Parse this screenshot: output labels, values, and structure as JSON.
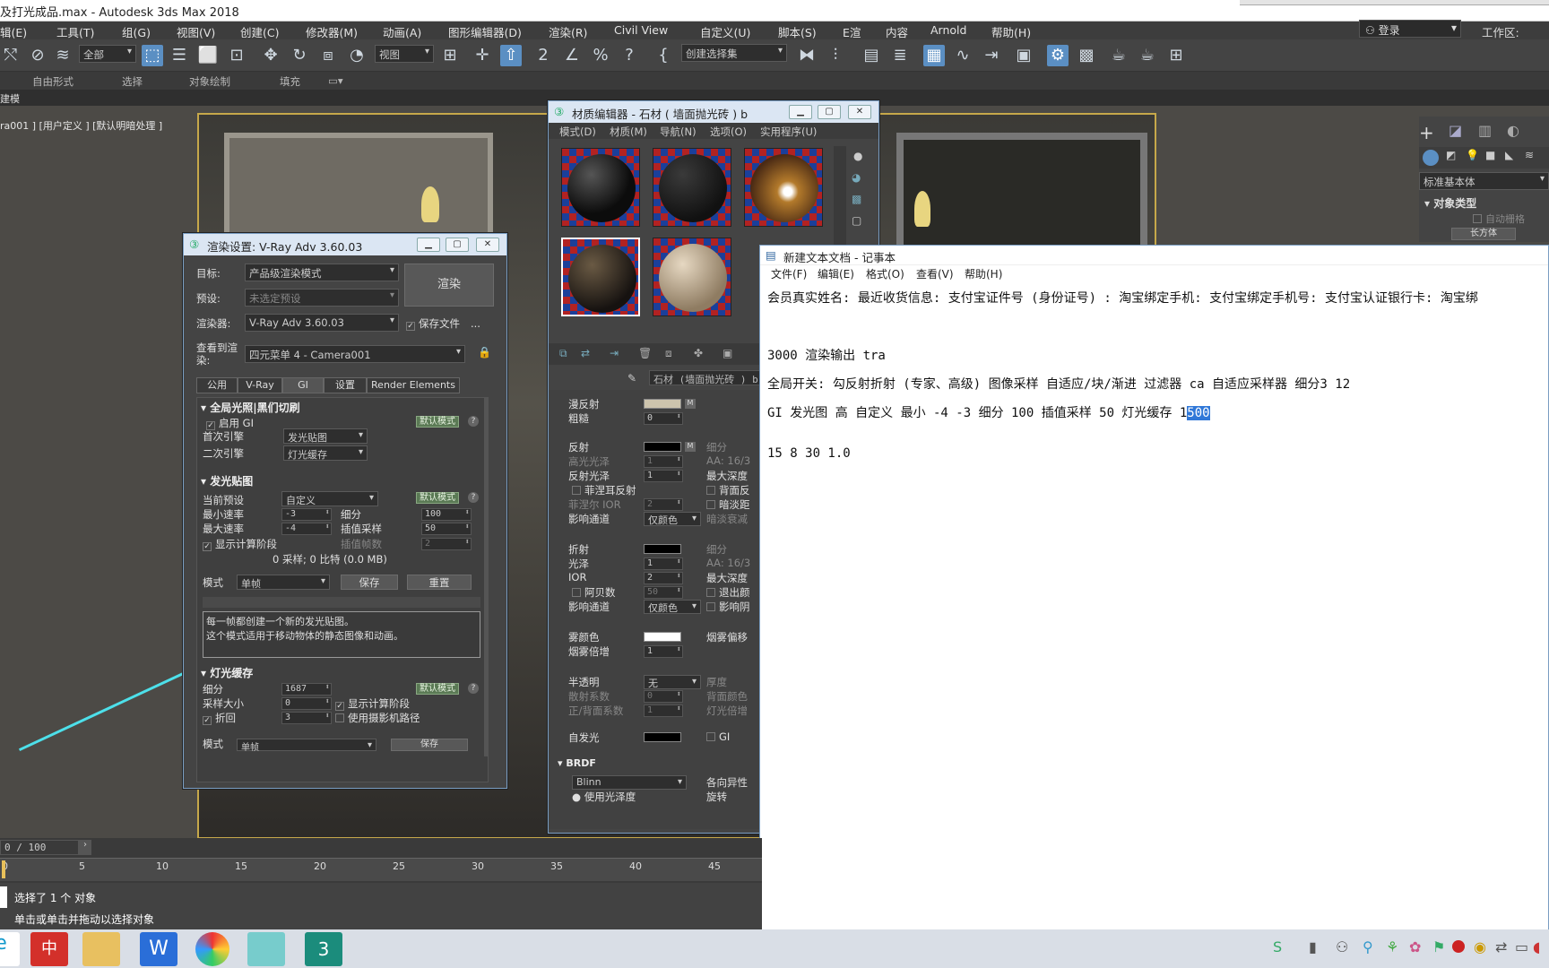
{
  "title_bar": {
    "title": "及打光成品.max - Autodesk 3ds Max 2018"
  },
  "menu": {
    "items": [
      "辑(E)",
      "工具(T)",
      "组(G)",
      "视图(V)",
      "创建(C)",
      "修改器(M)",
      "动画(A)",
      "图形编辑器(D)",
      "渲染(R)",
      "Civil View",
      "自定义(U)",
      "脚本(S)",
      "E渲",
      "内容",
      "Arnold",
      "帮助(H)"
    ],
    "login": "登录",
    "workspace": "工作区:"
  },
  "toolbar": {
    "filter_select": "全部",
    "ref_coord": "视图",
    "selection_set": "创建选择集"
  },
  "ribbon": {
    "tabs": [
      "自由形式",
      "选择",
      "对象绘制",
      "填充"
    ],
    "sub_label": "建模"
  },
  "viewport": {
    "label": "ra001 ] [用户定义 ] [默认明暗处理 ]"
  },
  "command_panel": {
    "category": "标准基本体",
    "rollout": "对象类型",
    "autogrid": "自动栅格",
    "button": "长方体"
  },
  "render_setup": {
    "title": "渲染设置: V-Ray Adv 3.60.03",
    "target_label": "目标:",
    "target_value": "产品级渲染模式",
    "preset_label": "预设:",
    "preset_value": "未选定预设",
    "renderer_label": "渲染器:",
    "renderer_value": "V-Ray Adv 3.60.03",
    "save_file": "保存文件",
    "view_label": "查看到渲染:",
    "view_value": "四元菜单 4 - Camera001",
    "render_button": "渲染",
    "tabs": [
      "公用",
      "V-Ray",
      "GI",
      "设置",
      "Render Elements"
    ],
    "gi": {
      "rollout_title": "全局光照|黑们切刷",
      "enable": "启用 GI",
      "mode_button": "默认模式",
      "primary_label": "首次引擎",
      "primary_value": "发光贴图",
      "secondary_label": "二次引擎",
      "secondary_value": "灯光缓存"
    },
    "irradiance": {
      "rollout_title": "发光贴图",
      "preset_label": "当前预设",
      "preset_value": "自定义",
      "mode_button": "默认模式",
      "min_rate_label": "最小速率",
      "min_rate": "-3",
      "max_rate_label": "最大速率",
      "max_rate": "-4",
      "subdivs_label": "细分",
      "subdivs": "100",
      "interp_label": "插值采样",
      "interp": "50",
      "show_calc": "显示计算阶段",
      "interp_frames_label": "插值帧数",
      "interp_frames": "2",
      "stats": "0 采样; 0 比特 (0.0 MB)",
      "mode_label": "模式",
      "mode_value": "单帧",
      "save": "保存",
      "reset": "重置",
      "description_1": "每一帧都创建一个新的发光贴图。",
      "description_2": "这个模式适用于移动物体的静态图像和动画。"
    },
    "light_cache": {
      "rollout_title": "灯光缓存",
      "mode_button": "默认模式",
      "subdivs_label": "细分",
      "subdivs": "1687",
      "sample_label": "采样大小",
      "sample": "0",
      "bounce_label": "折回",
      "bounce": "3",
      "show_calc": "显示计算阶段",
      "camera_path": "使用摄影机路径",
      "mode_label": "模式",
      "mode_value": "单帧",
      "save": "保存"
    }
  },
  "material_editor": {
    "title": "材质编辑器 - 石材 ( 墙面抛光砖 ) b",
    "menu": [
      "模式(D)",
      "材质(M)",
      "导航(N)",
      "选项(O)",
      "实用程序(U)"
    ],
    "material_name": "石材 (墙面抛光砖 ) b",
    "diffuse": "漫反射",
    "roughness": "粗糙",
    "roughness_val": "0",
    "reflect": "反射",
    "subdiv_label": "细分",
    "hilight_gloss": "高光光泽",
    "hilight_val": "1",
    "aa_label": "AA: 16/3",
    "refl_gloss": "反射光泽",
    "refl_gloss_val": "1",
    "max_depth": "最大深度",
    "fresnel": "菲涅耳反射",
    "back_reflect": "背面反",
    "fresnel_ior": "菲涅尔 IOR",
    "fresnel_ior_val": "2",
    "dim_dist": "暗淡距",
    "affect_ch": "影响通道",
    "affect_val": "仅颜色",
    "dim_falloff": "暗淡衰减",
    "refract": "折射",
    "gloss": "光泽",
    "gloss_val": "1",
    "ior": "IOR",
    "ior_val": "2",
    "abbe": "阿贝数",
    "abbe_val": "50",
    "exit_color": "退出颜",
    "affect_ch2": "影响通道",
    "affect_val2": "仅颜色",
    "affect_shadow": "影响阴",
    "fog_color": "雾颜色",
    "fog_bias": "烟雾偏移",
    "fog_mult": "烟雾倍增",
    "fog_mult_val": "1",
    "translucency": "半透明",
    "translucency_val": "无",
    "thickness": "厚度",
    "scatter": "散射系数",
    "scatter_val": "0",
    "back_color": "背面颜色",
    "fb": "正/背面系数",
    "fb_val": "1",
    "light_mult": "灯光倍增",
    "self_illum": "自发光",
    "gi": "GI",
    "brdf": "BRDF",
    "brdf_val": "Blinn",
    "anisotropy": "各向异性",
    "use_gloss": "使用光泽度",
    "rotation": "旋转"
  },
  "notepad": {
    "title": "新建文本文档 - 记事本",
    "menu": [
      "文件(F)",
      "编辑(E)",
      "格式(O)",
      "查看(V)",
      "帮助(H)"
    ],
    "line1": "会员真实姓名: 最近收货信息: 支付宝证件号 (身份证号) : 淘宝绑定手机: 支付宝绑定手机号: 支付宝认证银行卡: 淘宝绑",
    "line2": "3000  渲染输出 tra",
    "line3": "全局开关: 勾反射折射 (专家、高级)    图像采样 自适应/块/渐进  过滤器  ca  自适应采样器 细分3 12",
    "line4_pre": "GI 发光图  高    自定义  最小 -4  -3  细分 100  插值采样 50  灯光缓存 1",
    "line4_sel": "500",
    "line5": "15  8  30  1.0"
  },
  "timeline": {
    "frame": "0 / 100",
    "ticks": [
      "0",
      "5",
      "10",
      "15",
      "20",
      "25",
      "30",
      "35",
      "40",
      "45"
    ]
  },
  "status": {
    "line1": "选择了 1 个 对象",
    "line2": "单击或单击并拖动以选择对象"
  }
}
